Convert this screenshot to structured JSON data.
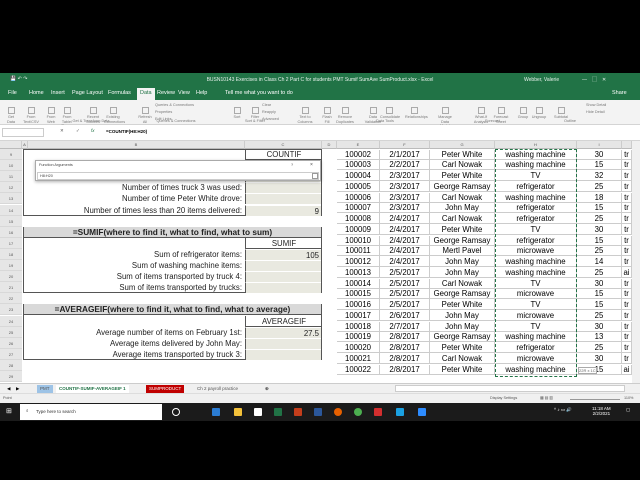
{
  "window": {
    "title": "BUSN10143 Exercises in Class Ch 2 Part C for students PMT Sumif SumAve SumProduct.xlsx  -  Excel",
    "user": "Webber, Valerie"
  },
  "menu_tabs": [
    "File",
    "Home",
    "Insert",
    "Page Layout",
    "Formulas",
    "Data",
    "Review",
    "View",
    "Help"
  ],
  "tell_me": "Tell me what you want to do",
  "share": "Share",
  "ribbon": {
    "items": [
      [
        "Get",
        "Data"
      ],
      [
        "From",
        "Text/CSV"
      ],
      [
        "From",
        "Web"
      ],
      [
        "From Table/",
        "Range"
      ],
      [
        "Recent",
        "Sources"
      ],
      [
        "Existing",
        "Connections"
      ],
      [
        "Refresh",
        "All"
      ],
      [
        "Sort",
        ""
      ],
      [
        "Filter",
        ""
      ],
      [
        "Text to",
        "Columns"
      ],
      [
        "Flash",
        "Fill"
      ],
      [
        "Remove",
        "Duplicates"
      ],
      [
        "Data",
        "Validation"
      ],
      [
        "Consolidate",
        ""
      ],
      [
        "Relationships",
        ""
      ],
      [
        "Manage",
        "Data Model"
      ],
      [
        "What-If",
        "Analysis"
      ],
      [
        "Forecast",
        "Sheet"
      ],
      [
        "Group",
        ""
      ],
      [
        "Ungroup",
        ""
      ],
      [
        "Subtotal",
        ""
      ]
    ],
    "small": [
      "Queries & Connections",
      "Properties",
      "Edit Links",
      "Clear",
      "Reapply",
      "Advanced",
      "Show Detail",
      "Hide Detail"
    ],
    "groups": [
      "Get & Transform Data",
      "Queries & Connections",
      "Sort & Filter",
      "Data Tools",
      "Forecast",
      "Outline"
    ]
  },
  "formula_bar": {
    "name_box": "",
    "formula": "=COUNTIF(H8:H20)"
  },
  "columns": [
    "A",
    "B",
    "C",
    "D",
    "E",
    "F",
    "G",
    "H",
    "I"
  ],
  "rows": [
    "9",
    "10",
    "11",
    "12",
    "13",
    "14",
    "15",
    "16",
    "17",
    "18",
    "19",
    "20",
    "21",
    "22",
    "23",
    "24",
    "25",
    "26",
    "27",
    "28",
    "29"
  ],
  "dialog": {
    "title": "Function Arguments",
    "help": "?",
    "close": "×",
    "value": "H8:H20"
  },
  "countif": {
    "header": "COUNTIF",
    "rows": [
      {
        "label": "Number of times truck 3 was used:",
        "value": ""
      },
      {
        "label": "Number of time Peter White drove:",
        "value": ""
      },
      {
        "label": "Number of times less than 20 items delivered:",
        "value": "9"
      }
    ]
  },
  "sumif": {
    "title": "=SUMIF(where to find it, what to find, what to sum)",
    "header": "SUMIF",
    "rows": [
      {
        "label": "Sum of refrigerator items:",
        "value": "105"
      },
      {
        "label": "Sum of washing machine items:",
        "value": ""
      },
      {
        "label": "Sum of items transported by truck 4:",
        "value": ""
      },
      {
        "label": "Sum of items transported by trucks:",
        "value": ""
      }
    ]
  },
  "averageif": {
    "title": "=AVERAGEIF(where to find it, what to find, what to average)",
    "header": "AVERAGEIF",
    "rows": [
      {
        "label": "Average number of items on February 1st:",
        "value": "27.5"
      },
      {
        "label": "Average items delivered by John May:",
        "value": ""
      },
      {
        "label": "Average items transported by truck 3:",
        "value": ""
      }
    ]
  },
  "data_rows": [
    [
      "100002",
      "2/1/2017",
      "Peter White",
      "washing machine",
      "30",
      "tr"
    ],
    [
      "100003",
      "2/2/2017",
      "Carl Nowak",
      "washing machine",
      "15",
      "tr"
    ],
    [
      "100004",
      "2/3/2017",
      "Peter White",
      "TV",
      "32",
      "tr"
    ],
    [
      "100005",
      "2/3/2017",
      "George Ramsay",
      "refrigerator",
      "25",
      "tr"
    ],
    [
      "100006",
      "2/3/2017",
      "Carl Nowak",
      "washing machine",
      "18",
      "tr"
    ],
    [
      "100007",
      "2/3/2017",
      "John May",
      "refrigerator",
      "15",
      "tr"
    ],
    [
      "100008",
      "2/4/2017",
      "Carl Nowak",
      "refrigerator",
      "25",
      "tr"
    ],
    [
      "100009",
      "2/4/2017",
      "Peter White",
      "TV",
      "30",
      "tr"
    ],
    [
      "100010",
      "2/4/2017",
      "George Ramsay",
      "refrigerator",
      "15",
      "tr"
    ],
    [
      "100011",
      "2/4/2017",
      "Mertl Pavel",
      "microwave",
      "25",
      "tr"
    ],
    [
      "100012",
      "2/4/2017",
      "John May",
      "washing machine",
      "14",
      "tr"
    ],
    [
      "100013",
      "2/5/2017",
      "John May",
      "washing machine",
      "25",
      "ai"
    ],
    [
      "100014",
      "2/5/2017",
      "Carl Nowak",
      "TV",
      "30",
      "tr"
    ],
    [
      "100015",
      "2/5/2017",
      "George Ramsay",
      "microwave",
      "15",
      "tr"
    ],
    [
      "100016",
      "2/5/2017",
      "Peter White",
      "TV",
      "15",
      "tr"
    ],
    [
      "100017",
      "2/6/2017",
      "John May",
      "microwave",
      "25",
      "tr"
    ],
    [
      "100018",
      "2/7/2017",
      "John May",
      "TV",
      "30",
      "tr"
    ],
    [
      "100019",
      "2/8/2017",
      "George Ramsay",
      "washing machine",
      "13",
      "tr"
    ],
    [
      "100020",
      "2/8/2017",
      "Peter White",
      "refrigerator",
      "25",
      "tr"
    ],
    [
      "100021",
      "2/8/2017",
      "Carl Nowak",
      "microwave",
      "30",
      "tr"
    ],
    [
      "100022",
      "2/8/2017",
      "Peter White",
      "washing machine",
      "15",
      "ai"
    ]
  ],
  "selection_tip": "22R x 1C",
  "sheet_tabs": [
    {
      "label": "PMT",
      "color": "#9dc3e6"
    },
    {
      "label": "COUNTIF-SUMIF-AVERAGEIF 1",
      "color": "#ffffff"
    },
    {
      "label": "SUMPRODUCT",
      "color": "#c00000"
    },
    {
      "label": "Ch 2 payroll practice",
      "color": "#f0f0f0"
    }
  ],
  "status": {
    "mode": "Point",
    "display_settings": "Display Settings",
    "zoom": "110%"
  },
  "taskbar": {
    "search_placeholder": "Type here to search",
    "time": "11:18 AM",
    "date": "2/2/2021"
  },
  "colors": {
    "excel_green": "#217346"
  }
}
